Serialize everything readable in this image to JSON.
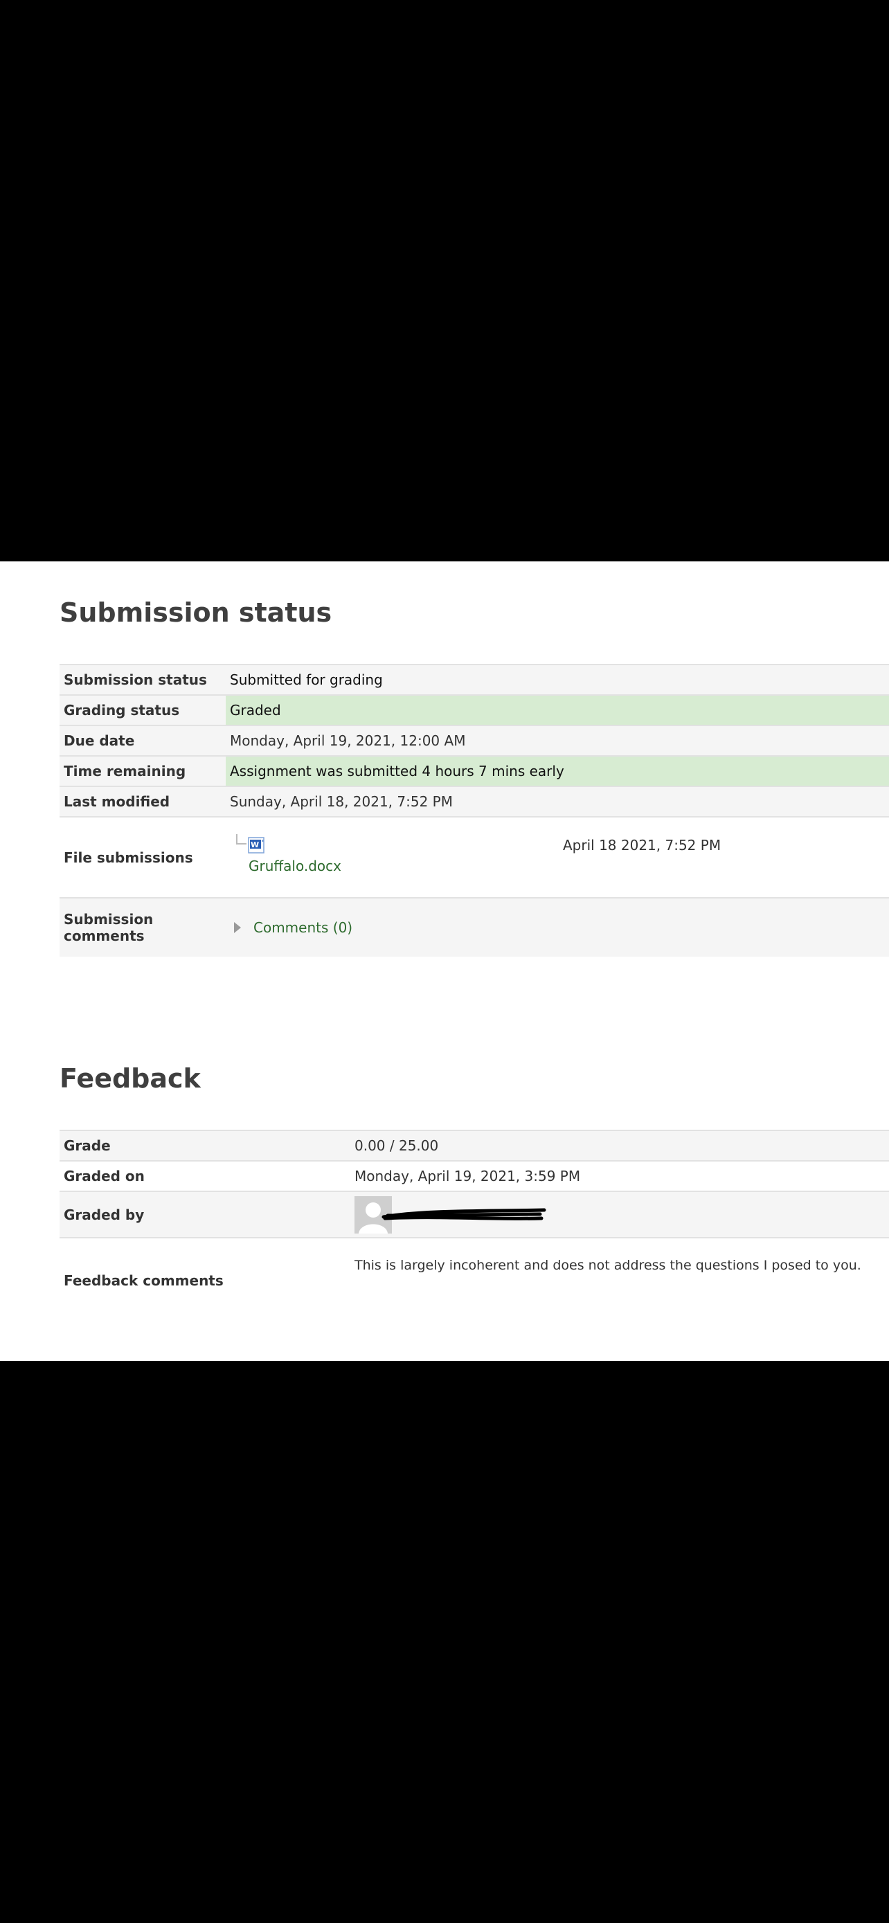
{
  "submission": {
    "heading": "Submission status",
    "rows": {
      "submission_status": {
        "label": "Submission status",
        "value": "Submitted for grading"
      },
      "grading_status": {
        "label": "Grading status",
        "value": "Graded"
      },
      "due_date": {
        "label": "Due date",
        "value": "Monday, April 19, 2021, 12:00 AM"
      },
      "time_remaining": {
        "label": "Time remaining",
        "value": "Assignment was submitted 4 hours 7 mins early"
      },
      "last_modified": {
        "label": "Last modified",
        "value": "Sunday, April 18, 2021, 7:52 PM"
      },
      "file_submissions": {
        "label": "File submissions",
        "file_name": "Gruffalo.docx",
        "file_date": "April 18 2021, 7:52 PM",
        "file_icon": "word-doc-icon"
      },
      "submission_comments": {
        "label": "Submission comments",
        "link": "Comments (0)"
      }
    }
  },
  "feedback": {
    "heading": "Feedback",
    "rows": {
      "grade": {
        "label": "Grade",
        "value": "0.00 / 25.00"
      },
      "graded_on": {
        "label": "Graded on",
        "value": "Monday, April 19, 2021, 3:59 PM"
      },
      "graded_by": {
        "label": "Graded by",
        "avatar_icon": "user-avatar-icon"
      },
      "feedback_comments": {
        "label": "Feedback comments",
        "value": "This is largely incoherent and does not address the questions I posed to you."
      }
    }
  },
  "colors": {
    "highlight": "#d7ecd2",
    "link": "#2e6b2e",
    "heading": "#3f3f3f"
  }
}
